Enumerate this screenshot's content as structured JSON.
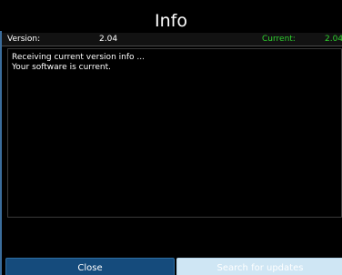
{
  "dialog": {
    "title": "Info"
  },
  "version_row": {
    "version_label": "Version:",
    "version_value": "2.04",
    "current_label": "Current:",
    "current_value": "2.04"
  },
  "log": {
    "lines": [
      "Receiving current version info ...",
      "Your software is current."
    ]
  },
  "buttons": {
    "close_label": "Close",
    "update_label": "Search for updates"
  },
  "colors": {
    "background": "#000000",
    "current_green": "#2fd12f",
    "primary_button": "#154b7c",
    "secondary_button": "#cfe6f4"
  }
}
